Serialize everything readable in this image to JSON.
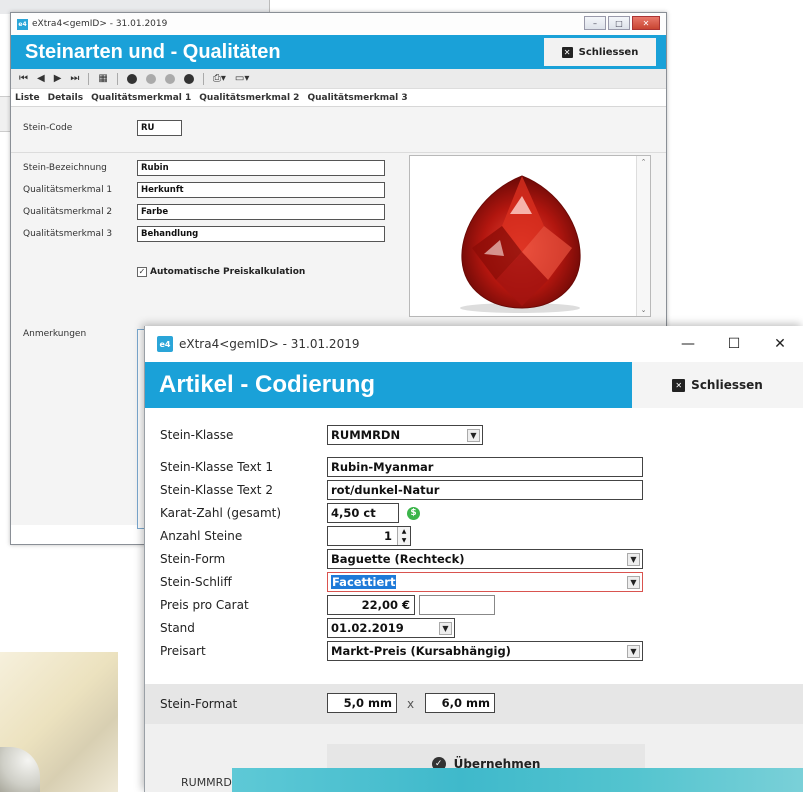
{
  "window1": {
    "app_title": "eXtra4<gemID> - 31.01.2019",
    "header_title": "Steinarten und - Qualitäten",
    "close_label": "Schliessen",
    "toolbar_icons": [
      "first-icon",
      "prev-icon",
      "next-icon",
      "last-icon",
      "grid-icon",
      "add-icon",
      "check-icon",
      "cancel-icon",
      "delete-icon",
      "print-icon",
      "export-icon"
    ],
    "tabs": [
      {
        "label": "Liste"
      },
      {
        "label": "Details"
      },
      {
        "label": "Qualitätsmerkmal 1"
      },
      {
        "label": "Qualitätsmerkmal 2"
      },
      {
        "label": "Qualitätsmerkmal 3"
      }
    ],
    "fields": {
      "code": {
        "label": "Stein-Code",
        "value": "RU"
      },
      "bezeichnung": {
        "label": "Stein-Bezeichnung",
        "value": "Rubin"
      },
      "qm1": {
        "label": "Qualitätsmerkmal 1",
        "value": "Herkunft"
      },
      "qm2": {
        "label": "Qualitätsmerkmal 2",
        "value": "Farbe"
      },
      "qm3": {
        "label": "Qualitätsmerkmal 3",
        "value": "Behandlung"
      },
      "auto_preis": {
        "label": "Automatische Preiskalkulation",
        "checked": true
      },
      "anmerkungen": {
        "label": "Anmerkungen"
      }
    },
    "image_desc": "ruby-gem-photo"
  },
  "window2": {
    "app_title": "eXtra4<gemID> - 31.01.2019",
    "header_title": "Artikel - Codierung",
    "close_label": "Schliessen",
    "fields": {
      "klasse": {
        "label": "Stein-Klasse",
        "value": "RUMMRDN"
      },
      "klasse_text1": {
        "label": "Stein-Klasse Text 1",
        "value": "Rubin-Myanmar"
      },
      "klasse_text2": {
        "label": "Stein-Klasse Text 2",
        "value": "rot/dunkel-Natur"
      },
      "karat": {
        "label": "Karat-Zahl (gesamt)",
        "value": "4,50 ct"
      },
      "anzahl": {
        "label": "Anzahl Steine",
        "value": "1"
      },
      "form": {
        "label": "Stein-Form",
        "value": "Baguette (Rechteck)"
      },
      "schliff": {
        "label": "Stein-Schliff",
        "value": "Facettiert"
      },
      "preis_carat": {
        "label": "Preis pro Carat",
        "value": "22,00 €"
      },
      "stand": {
        "label": "Stand",
        "value": "01.02.2019"
      },
      "preisart": {
        "label": "Preisart",
        "value": "Markt-Preis (Kursabhängig)"
      },
      "format": {
        "label": "Stein-Format",
        "width": "5,0 mm",
        "times": "x",
        "height": "6,0 mm"
      }
    },
    "apply_label": "Übernehmen",
    "status_text": "RUMMRD"
  },
  "colors": {
    "accent": "#1aa1d8",
    "error_border": "#d9534f",
    "ok_icon": "#3bb54a"
  }
}
